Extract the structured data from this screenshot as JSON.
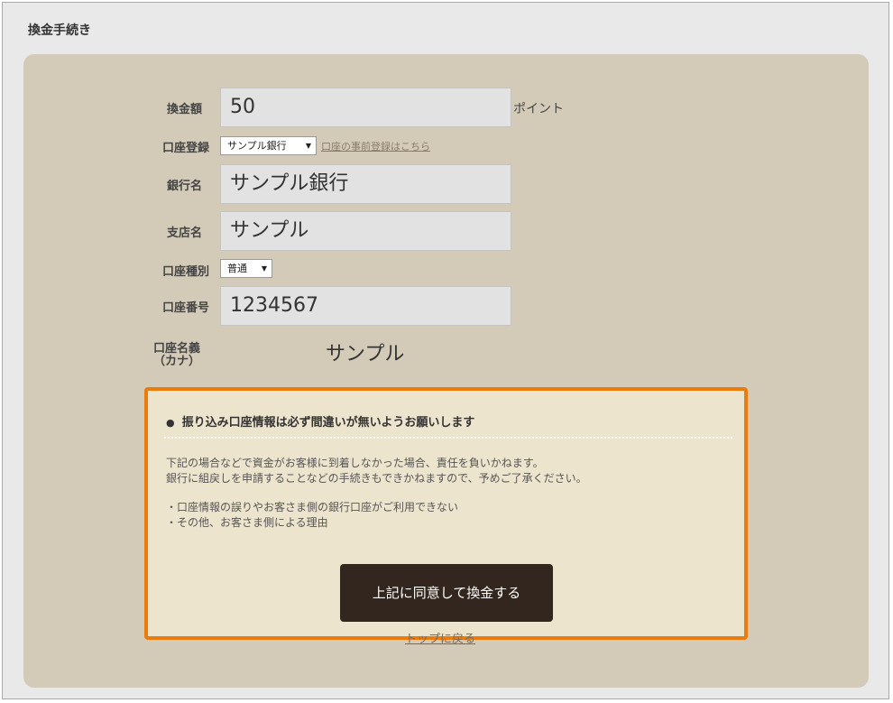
{
  "page": {
    "title": "換金手続き"
  },
  "form": {
    "amount": {
      "label": "換金額",
      "value": "50",
      "suffix": "ポイント"
    },
    "account_registration": {
      "label": "口座登録",
      "selected": "サンプル銀行",
      "link": "口座の事前登録はこちら"
    },
    "bank_name": {
      "label": "銀行名",
      "value": "サンプル銀行"
    },
    "branch_name": {
      "label": "支店名",
      "value": "サンプル"
    },
    "account_type": {
      "label": "口座種別",
      "selected": "普通"
    },
    "account_number": {
      "label": "口座番号",
      "value": "1234567"
    },
    "account_holder": {
      "label_line1": "口座名義",
      "label_line2": "（カナ）",
      "value": "サンプル"
    }
  },
  "notice": {
    "title": "振り込み口座情報は必ず間違いが無いようお願いします",
    "line1": "下記の場合などで資金がお客様に到着しなかった場合、責任を負いかねます。",
    "line2": "銀行に組戻しを申請することなどの手続きもできかねますので、予めご了承ください。",
    "bullet1": "・口座情報の誤りやお客さま側の銀行口座がご利用できない",
    "bullet2": "・その他、お客さま側による理由",
    "agree_button": "上記に同意して換金する"
  },
  "footer": {
    "back_link": "トップに戻る"
  },
  "colors": {
    "panel_bg": "#d3cbb8",
    "notice_border": "#ea7b0c",
    "notice_bg": "#ede4cd",
    "button_bg": "#33261e"
  }
}
